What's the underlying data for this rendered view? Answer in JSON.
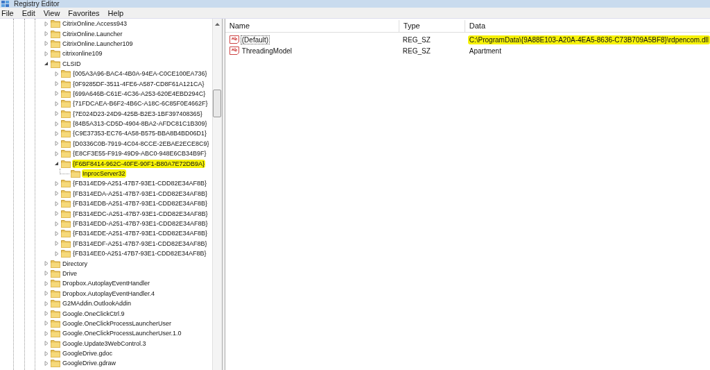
{
  "window": {
    "title": "Registry Editor"
  },
  "menu": [
    "File",
    "Edit",
    "View",
    "Favorites",
    "Help"
  ],
  "tree": [
    {
      "label": "CitrixOnline.Access943",
      "expanded": false
    },
    {
      "label": "CitrixOnline.Launcher",
      "expanded": false
    },
    {
      "label": "CitrixOnline.Launcher109",
      "expanded": false
    },
    {
      "label": "citrixonline109",
      "expanded": false
    },
    {
      "label": "CLSID",
      "expanded": true,
      "children": [
        {
          "label": "{005A3A96-BAC4-4B0A-94EA-C0CE100EA736}",
          "expanded": false
        },
        {
          "label": "{0F9285DF-3511-4FE6-A587-CD8F61A121CA}",
          "expanded": false
        },
        {
          "label": "{699A646B-C61E-4C36-A253-620E4EBD294C}",
          "expanded": false
        },
        {
          "label": "{71FDCAEA-B6F2-4B6C-A18C-6C85F0E4662F}",
          "expanded": false
        },
        {
          "label": "{7E024D23-24D9-425B-B2E3-1BF397408365}",
          "expanded": false
        },
        {
          "label": "{84B5A313-CD5D-4904-8BA2-AFDC81C1B309}",
          "expanded": false
        },
        {
          "label": "{C9E37353-EC76-4A58-B575-BBA8B4BD06D1}",
          "expanded": false
        },
        {
          "label": "{D0336C0B-7919-4C04-8CCE-2EBAE2ECE8C9}",
          "expanded": false
        },
        {
          "label": "{E8CF3E55-F919-49D9-ABC0-948E6CB34B9F}",
          "expanded": false
        },
        {
          "label": "{F6BF8414-962C-40FE-90F1-B80A7E72DB9A}",
          "expanded": true,
          "highlighted": true,
          "children": [
            {
              "label": "InprocServer32",
              "highlighted": true
            }
          ]
        },
        {
          "label": "{FB314ED9-A251-47B7-93E1-CDD82E34AF8B}",
          "expanded": false
        },
        {
          "label": "{FB314EDA-A251-47B7-93E1-CDD82E34AF8B}",
          "expanded": false
        },
        {
          "label": "{FB314EDB-A251-47B7-93E1-CDD82E34AF8B}",
          "expanded": false
        },
        {
          "label": "{FB314EDC-A251-47B7-93E1-CDD82E34AF8B}",
          "expanded": false
        },
        {
          "label": "{FB314EDD-A251-47B7-93E1-CDD82E34AF8B}",
          "expanded": false
        },
        {
          "label": "{FB314EDE-A251-47B7-93E1-CDD82E34AF8B}",
          "expanded": false
        },
        {
          "label": "{FB314EDF-A251-47B7-93E1-CDD82E34AF8B}",
          "expanded": false
        },
        {
          "label": "{FB314EE0-A251-47B7-93E1-CDD82E34AF8B}",
          "expanded": false
        }
      ]
    },
    {
      "label": "Directory",
      "expanded": false
    },
    {
      "label": "Drive",
      "expanded": false
    },
    {
      "label": "Dropbox.AutoplayEventHandler",
      "expanded": false
    },
    {
      "label": "Dropbox.AutoplayEventHandler.4",
      "expanded": false
    },
    {
      "label": "G2MAddin.OutlookAddin",
      "expanded": false
    },
    {
      "label": "Google.OneClickCtrl.9",
      "expanded": false
    },
    {
      "label": "Google.OneClickProcessLauncherUser",
      "expanded": false
    },
    {
      "label": "Google.OneClickProcessLauncherUser.1.0",
      "expanded": false
    },
    {
      "label": "Google.Update3WebControl.3",
      "expanded": false
    },
    {
      "label": "GoogleDrive.gdoc",
      "expanded": false
    },
    {
      "label": "GoogleDrive.gdraw",
      "expanded": false
    }
  ],
  "values": {
    "columns": [
      "Name",
      "Type",
      "Data"
    ],
    "rows": [
      {
        "name": "(Default)",
        "type": "REG_SZ",
        "data": "C:\\ProgramData\\{9A88E103-A20A-4EA5-8636-C73B709A5BF8}\\rdpencom.dll",
        "focused": true,
        "highlighted": true
      },
      {
        "name": "ThreadingModel",
        "type": "REG_SZ",
        "data": "Apartment",
        "focused": false,
        "highlighted": false
      }
    ]
  }
}
